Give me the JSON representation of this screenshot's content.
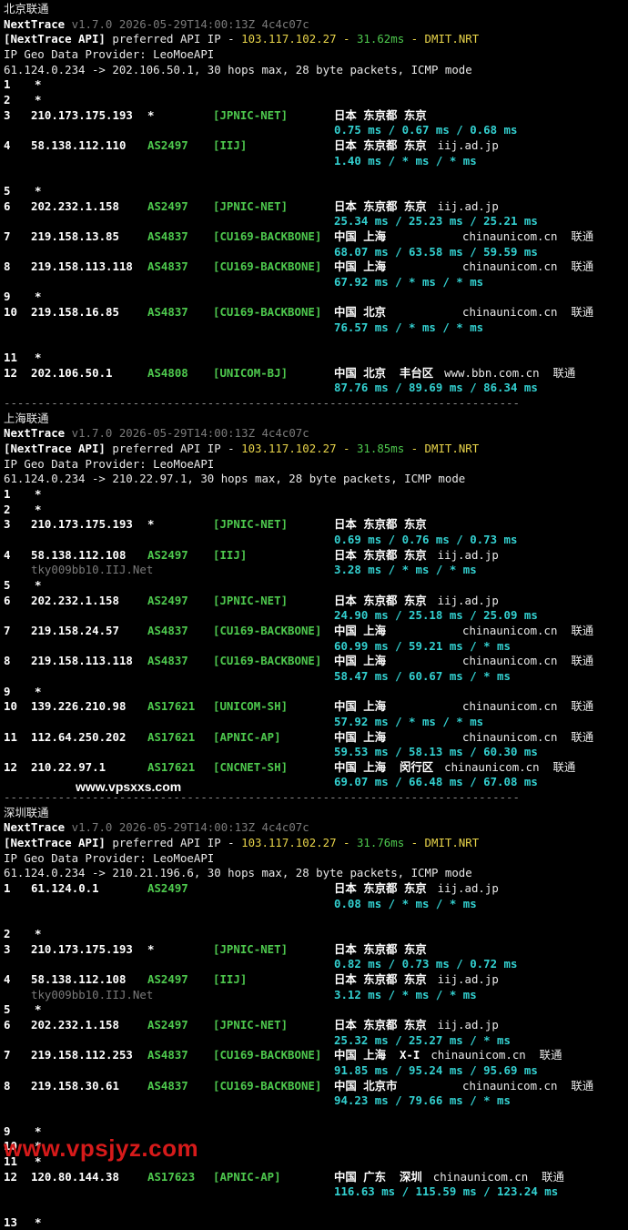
{
  "sections": [
    {
      "label": "北京联通",
      "version": "v1.7.0 2026-05-29T14:00:13Z 4c4c07c",
      "api_ip": "103.117.102.27",
      "api_latency": "31.62ms",
      "api_pop": "DMIT.NRT",
      "geo_provider": "IP Geo Data Provider: LeoMoeAPI",
      "route_line": "61.124.0.234 -> 202.106.50.1, 30 hops max, 28 byte packets, ICMP mode",
      "rows": [
        {
          "hop": "1",
          "ip": "*"
        },
        {
          "hop": "2",
          "ip": "*"
        },
        {
          "hop": "3",
          "ip": "210.173.175.193",
          "as": "*",
          "net": "[JPNIC-NET]",
          "geo": "日本 东京都 东京",
          "domain": "",
          "times": "0.75 ms / 0.67 ms / 0.68 ms"
        },
        {
          "hop": "4",
          "ip": "58.138.112.110",
          "as": "AS2497",
          "net": "[IIJ]",
          "geo": "日本 东京都 东京",
          "domain": "iij.ad.jp",
          "times": "1.40 ms / * ms / * ms",
          "spacer": true
        },
        {
          "hop": "5",
          "ip": "*"
        },
        {
          "hop": "6",
          "ip": "202.232.1.158",
          "as": "AS2497",
          "net": "[JPNIC-NET]",
          "geo": "日本 东京都 东京",
          "domain": "iij.ad.jp",
          "times": "25.34 ms / 25.23 ms / 25.21 ms"
        },
        {
          "hop": "7",
          "ip": "219.158.13.85",
          "as": "AS4837",
          "net": "[CU169-BACKBONE]",
          "geo": "中国 上海",
          "domain": "chinaunicom.cn  联通",
          "times": "68.07 ms / 63.58 ms / 59.59 ms"
        },
        {
          "hop": "8",
          "ip": "219.158.113.118",
          "as": "AS4837",
          "net": "[CU169-BACKBONE]",
          "geo": "中国 上海",
          "domain": "chinaunicom.cn  联通",
          "times": "67.92 ms / * ms / * ms"
        },
        {
          "hop": "9",
          "ip": "*"
        },
        {
          "hop": "10",
          "ip": "219.158.16.85",
          "as": "AS4837",
          "net": "[CU169-BACKBONE]",
          "geo": "中国 北京",
          "domain": "chinaunicom.cn  联通",
          "times": "76.57 ms / * ms / * ms",
          "spacer": true
        },
        {
          "hop": "11",
          "ip": "*"
        },
        {
          "hop": "12",
          "ip": "202.106.50.1",
          "as": "AS4808",
          "net": "[UNICOM-BJ]",
          "geo": "中国 北京  丰台区",
          "domain": "www.bbn.com.cn  联通",
          "times": "87.76 ms / 89.69 ms / 86.34 ms"
        }
      ]
    },
    {
      "label": "上海联通",
      "version": "v1.7.0 2026-05-29T14:00:13Z 4c4c07c",
      "api_ip": "103.117.102.27",
      "api_latency": "31.85ms",
      "api_pop": "DMIT.NRT",
      "geo_provider": "IP Geo Data Provider: LeoMoeAPI",
      "route_line": "61.124.0.234 -> 210.22.97.1, 30 hops max, 28 byte packets, ICMP mode",
      "rows": [
        {
          "hop": "1",
          "ip": "*"
        },
        {
          "hop": "2",
          "ip": "*"
        },
        {
          "hop": "3",
          "ip": "210.173.175.193",
          "as": "*",
          "net": "[JPNIC-NET]",
          "geo": "日本 东京都 东京",
          "domain": "",
          "times": "0.69 ms / 0.76 ms / 0.73 ms"
        },
        {
          "hop": "4",
          "ip": "58.138.112.108",
          "as": "AS2497",
          "net": "[IIJ]",
          "geo": "日本 东京都 东京",
          "domain": "iij.ad.jp",
          "times": "3.28 ms / * ms / * ms",
          "rdns": "tky009bb10.IIJ.Net"
        },
        {
          "hop": "5",
          "ip": "*"
        },
        {
          "hop": "6",
          "ip": "202.232.1.158",
          "as": "AS2497",
          "net": "[JPNIC-NET]",
          "geo": "日本 东京都 东京",
          "domain": "iij.ad.jp",
          "times": "24.90 ms / 25.18 ms / 25.09 ms"
        },
        {
          "hop": "7",
          "ip": "219.158.24.57",
          "as": "AS4837",
          "net": "[CU169-BACKBONE]",
          "geo": "中国 上海",
          "domain": "chinaunicom.cn  联通",
          "times": "60.99 ms / 59.21 ms / * ms"
        },
        {
          "hop": "8",
          "ip": "219.158.113.118",
          "as": "AS4837",
          "net": "[CU169-BACKBONE]",
          "geo": "中国 上海",
          "domain": "chinaunicom.cn  联通",
          "times": "58.47 ms / 60.67 ms / * ms"
        },
        {
          "hop": "9",
          "ip": "*"
        },
        {
          "hop": "10",
          "ip": "139.226.210.98",
          "as": "AS17621",
          "net": "[UNICOM-SH]",
          "geo": "中国 上海",
          "domain": "chinaunicom.cn  联通",
          "times": "57.92 ms / * ms / * ms"
        },
        {
          "hop": "11",
          "ip": "112.64.250.202",
          "as": "AS17621",
          "net": "[APNIC-AP]",
          "geo": "中国 上海",
          "domain": "chinaunicom.cn  联通",
          "times": "59.53 ms / 58.13 ms / 60.30 ms"
        },
        {
          "hop": "12",
          "ip": "210.22.97.1",
          "as": "AS17621",
          "net": "[CNCNET-SH]",
          "geo": "中国 上海  闵行区",
          "domain": "chinaunicom.cn  联通",
          "times": "69.07 ms / 66.48 ms / 67.08 ms"
        }
      ]
    },
    {
      "label": "深圳联通",
      "version": "v1.7.0 2026-05-29T14:00:13Z 4c4c07c",
      "api_ip": "103.117.102.27",
      "api_latency": "31.76ms",
      "api_pop": "DMIT.NRT",
      "geo_provider": "IP Geo Data Provider: LeoMoeAPI",
      "route_line": "61.124.0.234 -> 210.21.196.6, 30 hops max, 28 byte packets, ICMP mode",
      "rows": [
        {
          "hop": "1",
          "ip": "61.124.0.1",
          "as": "AS2497",
          "net": "",
          "geo": "日本 东京都 东京",
          "domain": "iij.ad.jp",
          "times": "0.08 ms / * ms / * ms",
          "spacer": true
        },
        {
          "hop": "2",
          "ip": "*"
        },
        {
          "hop": "3",
          "ip": "210.173.175.193",
          "as": "*",
          "net": "[JPNIC-NET]",
          "geo": "日本 东京都 东京",
          "domain": "",
          "times": "0.82 ms / 0.73 ms / 0.72 ms"
        },
        {
          "hop": "4",
          "ip": "58.138.112.108",
          "as": "AS2497",
          "net": "[IIJ]",
          "geo": "日本 东京都 东京",
          "domain": "iij.ad.jp",
          "times": "3.12 ms / * ms / * ms",
          "rdns": "tky009bb10.IIJ.Net"
        },
        {
          "hop": "5",
          "ip": "*"
        },
        {
          "hop": "6",
          "ip": "202.232.1.158",
          "as": "AS2497",
          "net": "[JPNIC-NET]",
          "geo": "日本 东京都 东京",
          "domain": "iij.ad.jp",
          "times": "25.32 ms / 25.27 ms / * ms"
        },
        {
          "hop": "7",
          "ip": "219.158.112.253",
          "as": "AS4837",
          "net": "[CU169-BACKBONE]",
          "geo": "中国 上海  X-I",
          "domain": "chinaunicom.cn  联通",
          "times": "91.85 ms / 95.24 ms / 95.69 ms"
        },
        {
          "hop": "8",
          "ip": "219.158.30.61",
          "as": "AS4837",
          "net": "[CU169-BACKBONE]",
          "geo": "中国 北京市",
          "domain": "chinaunicom.cn  联通",
          "times": "94.23 ms / 79.66 ms / * ms",
          "spacer": true
        },
        {
          "hop": "9",
          "ip": "*"
        },
        {
          "hop": "10",
          "ip": "*"
        },
        {
          "hop": "11",
          "ip": "*"
        },
        {
          "hop": "12",
          "ip": "120.80.144.38",
          "as": "AS17623",
          "net": "[APNIC-AP]",
          "geo": "中国 广东  深圳",
          "domain": "chinaunicom.cn  联通",
          "times": "116.63 ms / 115.59 ms / 123.24 ms",
          "spacer": true
        },
        {
          "hop": "13",
          "ip": "*"
        }
      ]
    }
  ],
  "separator": "----------------------------------------------------------------------------",
  "watermarks": {
    "top": "www.vpsxxs.com",
    "bottom": "www.vpsjyz.com"
  },
  "colors": {
    "background": "#000000",
    "text": "#c9c9c9",
    "green": "#4ec94e",
    "yellow": "#e8d44a",
    "cyan": "#33d0d0",
    "watermark_red": "#d61a1a"
  }
}
